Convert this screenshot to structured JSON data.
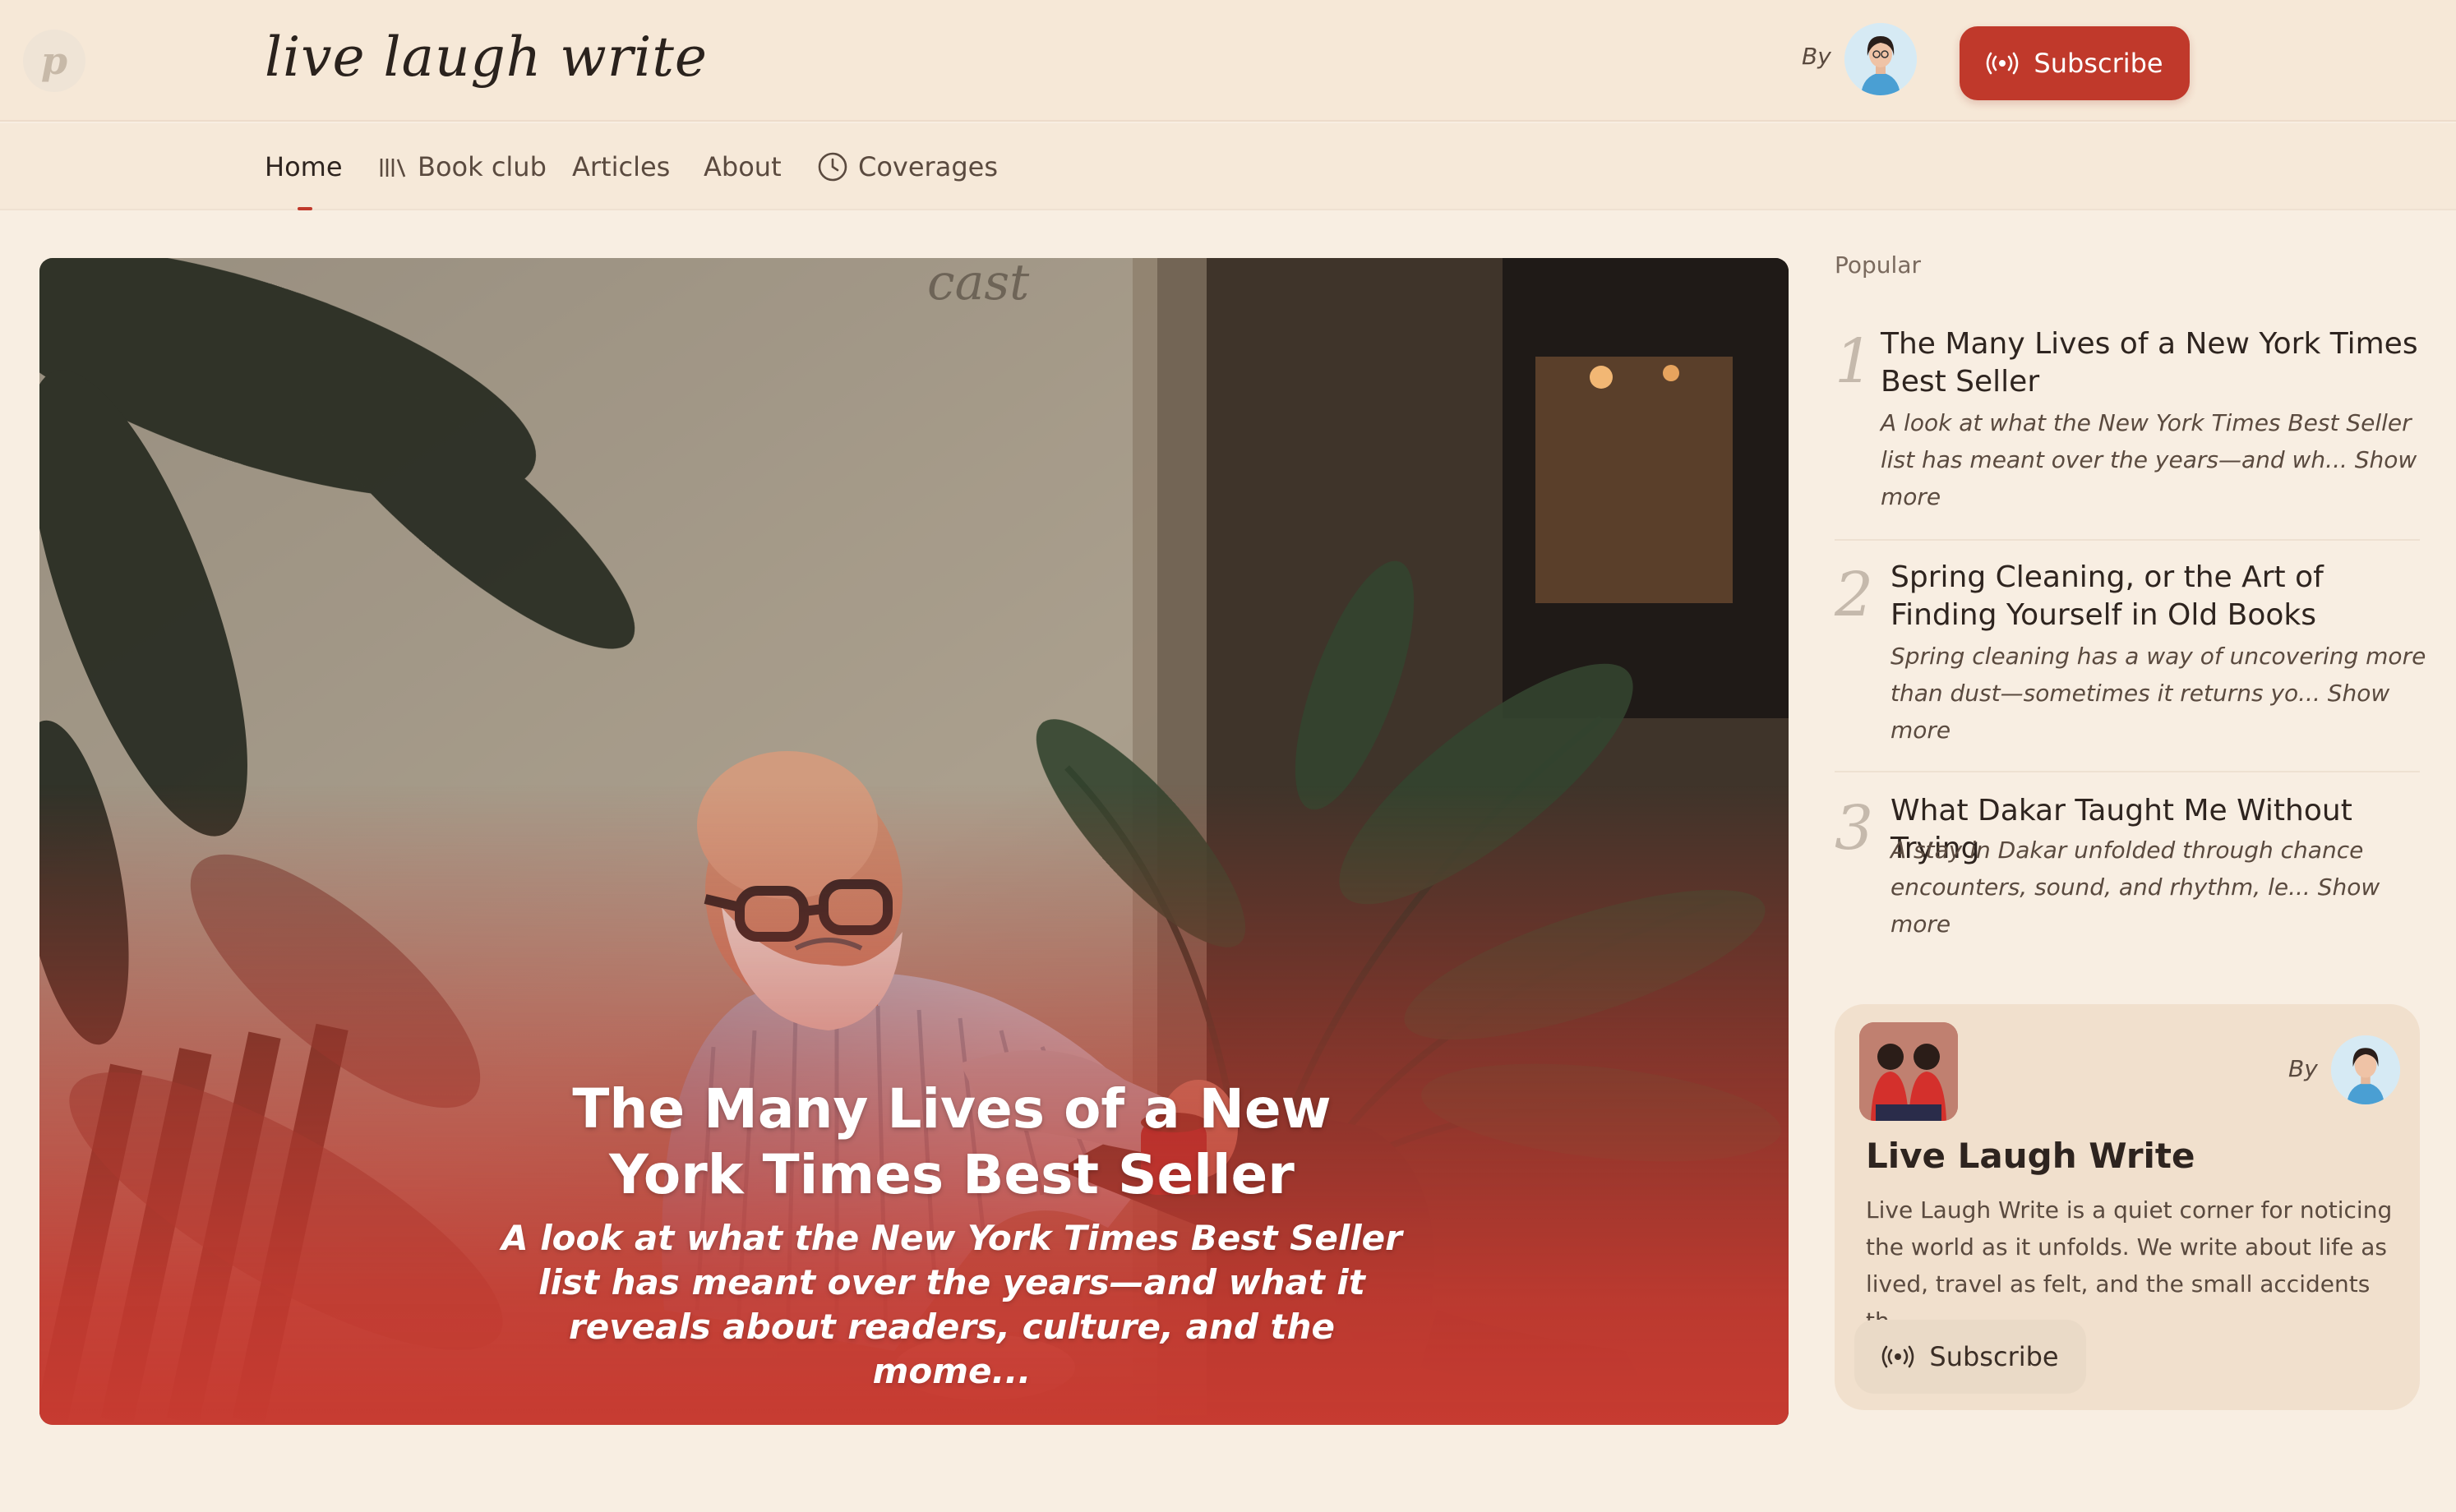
{
  "header": {
    "logo_letter": "p",
    "site_title": "live laugh write",
    "by_label": "By",
    "subscribe_label": "Subscribe",
    "accent_color": "#c0392b"
  },
  "nav": {
    "items": [
      {
        "label": "Home",
        "icon": null,
        "active": true
      },
      {
        "label": "Book club",
        "icon": "books-icon"
      },
      {
        "label": "Articles",
        "icon": null
      },
      {
        "label": "About",
        "icon": null
      },
      {
        "label": "Coverages",
        "icon": "clock-icon"
      }
    ]
  },
  "hero": {
    "title": "The Many Lives of a New York Times Best Seller",
    "subtitle": "A look at what the New York Times Best Seller list has meant over the years—and what it reveals about readers, culture, and the mome..."
  },
  "popular": {
    "label": "Popular",
    "items": [
      {
        "number": "1",
        "title": "The Many Lives of a New York Times Best Seller",
        "description": "A look at what the New York Times Best Seller list has meant over the years—and wh...",
        "show_more": "Show more"
      },
      {
        "number": "2",
        "title": "Spring Cleaning, or the Art of Finding Yourself in Old Books",
        "description": "Spring cleaning has a way of uncovering more than dust—sometimes it returns yo...",
        "show_more": "Show more"
      },
      {
        "number": "3",
        "title": "What Dakar Taught Me Without Trying",
        "description": "A stay in Dakar unfolded through chance encounters, sound, and rhythm, le...",
        "show_more": "Show more"
      }
    ]
  },
  "about_card": {
    "by_label": "By",
    "title": "Live Laugh Write",
    "description": "Live Laugh Write is a quiet corner for noticing the world as it unfolds. We write about life as lived, travel as felt, and the small accidents th...",
    "subscribe_label": "Subscribe"
  }
}
